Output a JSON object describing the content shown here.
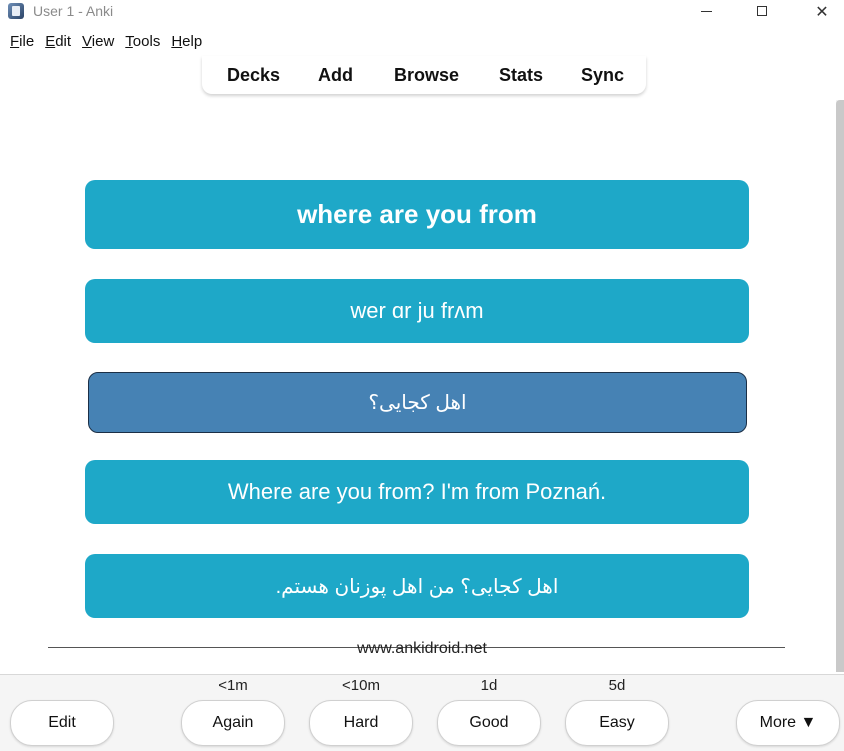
{
  "window": {
    "title": "User 1 - Anki",
    "minimize_glyph": "",
    "close_glyph": "✕"
  },
  "menu": [
    {
      "mnemonic": "F",
      "rest": "ile"
    },
    {
      "mnemonic": "E",
      "rest": "dit"
    },
    {
      "mnemonic": "V",
      "rest": "iew"
    },
    {
      "mnemonic": "T",
      "rest": "ools"
    },
    {
      "mnemonic": "H",
      "rest": "elp"
    }
  ],
  "toolbar": {
    "decks": "Decks",
    "add": "Add",
    "browse": "Browse",
    "stats": "Stats",
    "sync": "Sync"
  },
  "card": {
    "phrase": "where are you from",
    "ipa": "wer ɑr ju frʌm",
    "translation": "اهل کجایی؟",
    "example": "Where are you from? I'm from Poznań.",
    "example_translation": ".اهل کجایی؟ من اهل پوزنان هستم",
    "footer": "www.ankidroid.net"
  },
  "review": {
    "edit": "Edit",
    "again": {
      "label": "Again",
      "interval": "<1m"
    },
    "hard": {
      "label": "Hard",
      "interval": "<10m"
    },
    "good": {
      "label": "Good",
      "interval": "1d"
    },
    "easy": {
      "label": "Easy",
      "interval": "5d"
    },
    "more": "More ▼"
  },
  "colors": {
    "card": "#1ea8c8",
    "card_selected": "#4682b4"
  }
}
